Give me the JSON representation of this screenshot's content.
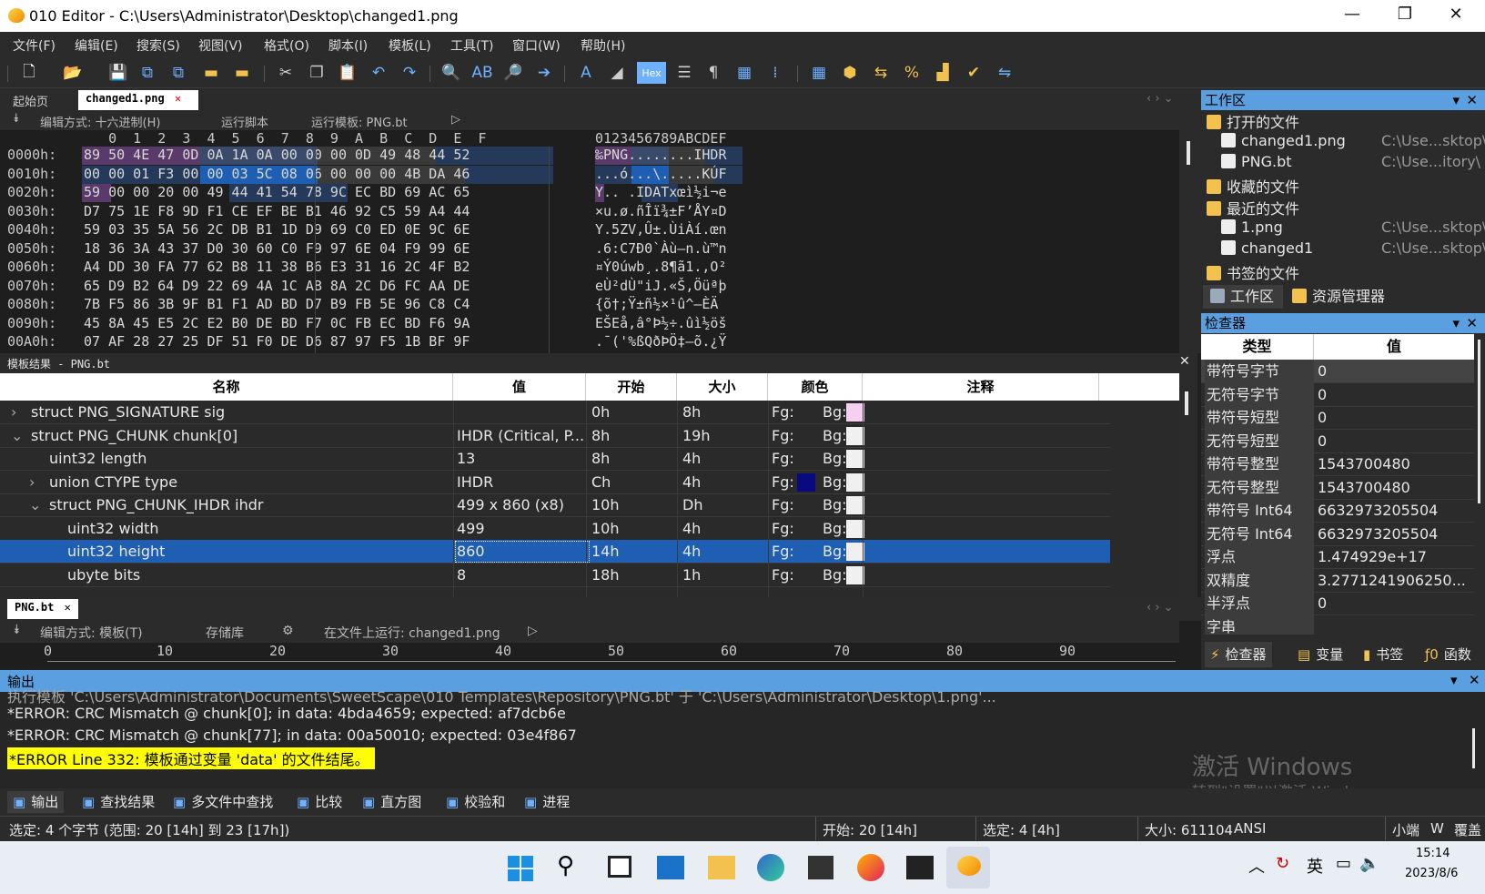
{
  "window": {
    "title": "010 Editor - C:\\Users\\Administrator\\Desktop\\changed1.png",
    "minimize": "—",
    "maximize": "❐",
    "close": "✕"
  },
  "menu": [
    "文件(F)",
    "编辑(E)",
    "搜索(S)",
    "视图(V)",
    "格式(O)",
    "脚本(I)",
    "模板(L)",
    "工具(T)",
    "窗口(W)",
    "帮助(H)"
  ],
  "tabs": {
    "start": "起始页",
    "file": "changed1.png",
    "close": "✕"
  },
  "hexbar": {
    "edit_mode": "编辑方式: 十六进制(H)",
    "run_script": "运行脚本",
    "run_template": "运行模板: PNG.bt"
  },
  "hex": {
    "col_header": "   0  1  2  3  4  5  6  7  8  9  A  B  C  D  E  F",
    "ascii_header": "0123456789ABCDEF",
    "rows": [
      {
        "addr": "0000h:",
        "bytes": "89 50 4E 47 0D 0A 1A 0A 00 00 00 0D 49 48 44 52",
        "ascii": "‰PNG........IHDR"
      },
      {
        "addr": "0010h:",
        "bytes": "00 00 01 F3 00 00 03 5C 08 06 00 00 00 4B DA 46",
        "ascii": "...ó...\\.....KÚF"
      },
      {
        "addr": "0020h:",
        "bytes": "59 00 00 20 00 49 44 41 54 78 9C EC BD 69 AC 65",
        "ascii": "Y.. .IDATxœì½i¬e"
      },
      {
        "addr": "0030h:",
        "bytes": "D7 75 1E F8 9D F1 CE EF BE B1 46 92 C5 59 A4 44",
        "ascii": "×u.ø.ñÎï¾±F’ÅY¤D"
      },
      {
        "addr": "0040h:",
        "bytes": "59 03 35 5A 56 2C DB B1 1D D9 69 C0 ED 0E 9C 6E",
        "ascii": "Y.5ZV,Û±.ÙiÀí.œn"
      },
      {
        "addr": "0050h:",
        "bytes": "18 36 3A 43 37 D0 30 60 C0 F9 97 6E 04 F9 99 6E",
        "ascii": ".6:C7Ð0`Àù—n.ù™n"
      },
      {
        "addr": "0060h:",
        "bytes": "A4 DD 30 FA 77 62 B8 11 38 B6 E3 31 16 2C 4F B2",
        "ascii": "¤Ý0úwb¸.8¶ã1.,O²"
      },
      {
        "addr": "0070h:",
        "bytes": "65 D9 B2 64 D9 22 69 4A 1C AB 8A 2C D6 FC AA DE",
        "ascii": "eÙ²dÙ\"iJ.«Š,Öüªþ"
      },
      {
        "addr": "0080h:",
        "bytes": "7B F5 86 3B 9F B1 F1 AD BD D7 B9 FB 5E 96 C8 C4",
        "ascii": "{õ†;Ÿ±ñ­½×¹û^–ÈÄ"
      },
      {
        "addr": "0090h:",
        "bytes": "45 8A 45 E5 2C E2 B0 DE BD F7 0C FB EC BD F6 9A",
        "ascii": "EŠEå,â°Þ½÷.ûì½öš"
      },
      {
        "addr": "00A0h:",
        "bytes": "07 AF 28 27 25 DF 51 F0 DE D6 87 97 F5 1B BF 9F",
        "ascii": ".¯('%ßQðÞÖ‡—õ.¿Ÿ"
      }
    ]
  },
  "template": {
    "title": "模板结果 - PNG.bt",
    "columns": [
      "名称",
      "值",
      "开始",
      "大小",
      "颜色",
      "注释"
    ],
    "rows": [
      {
        "name": "struct PNG_SIGNATURE sig",
        "value": "",
        "start": "0h",
        "size": "8h",
        "fg": "Fg:",
        "bg": "Bg:",
        "bgcolor": "#f5d0f0",
        "fgcolor": "",
        "indent": 0,
        "arrow": "›"
      },
      {
        "name": "struct PNG_CHUNK chunk[0]",
        "value": "IHDR  (Critical, P...",
        "start": "8h",
        "size": "19h",
        "fg": "Fg:",
        "bg": "Bg:",
        "bgcolor": "#f0f0f0",
        "fgcolor": "",
        "indent": 0,
        "arrow": "⌄"
      },
      {
        "name": "uint32 length",
        "value": "13",
        "start": "8h",
        "size": "4h",
        "fg": "Fg:",
        "bg": "Bg:",
        "bgcolor": "#f0f0f0",
        "fgcolor": "",
        "indent": 1,
        "arrow": ""
      },
      {
        "name": "union CTYPE type",
        "value": "IHDR",
        "start": "Ch",
        "size": "4h",
        "fg": "Fg:",
        "bg": "Bg:",
        "bgcolor": "#f0f0f0",
        "fgcolor": "#0a0a80",
        "indent": 1,
        "arrow": "›"
      },
      {
        "name": "struct PNG_CHUNK_IHDR ihdr",
        "value": "499 x 860 (x8)",
        "start": "10h",
        "size": "Dh",
        "fg": "Fg:",
        "bg": "Bg:",
        "bgcolor": "#f0f0f0",
        "fgcolor": "",
        "indent": 1,
        "arrow": "⌄"
      },
      {
        "name": "uint32 width",
        "value": "499",
        "start": "10h",
        "size": "4h",
        "fg": "Fg:",
        "bg": "Bg:",
        "bgcolor": "#f0f0f0",
        "fgcolor": "",
        "indent": 2,
        "arrow": ""
      },
      {
        "name": "uint32 height",
        "value": "860",
        "start": "14h",
        "size": "4h",
        "fg": "Fg:",
        "bg": "Bg:",
        "bgcolor": "#f0f0f0",
        "fgcolor": "",
        "indent": 2,
        "arrow": "",
        "selected": true
      },
      {
        "name": "ubyte bits",
        "value": "8",
        "start": "18h",
        "size": "1h",
        "fg": "Fg:",
        "bg": "Bg:",
        "bgcolor": "#f0f0f0",
        "fgcolor": "",
        "indent": 2,
        "arrow": ""
      }
    ]
  },
  "pngtab": {
    "label": "PNG.bt",
    "close": "✕"
  },
  "editbar2": {
    "edit_mode": "编辑方式: 模板(T)",
    "repo": "存储库",
    "run_on": "在文件上运行: changed1.png"
  },
  "ruler": [
    "0",
    "10",
    "20",
    "30",
    "40",
    "50",
    "60",
    "70",
    "80",
    "90"
  ],
  "output": {
    "title": "输出",
    "lines": [
      "执行模板 'C:\\Users\\Administrator\\Documents\\SweetScape\\010 Templates\\Repository\\PNG.bt' 于 'C:\\Users\\Administrator\\Desktop\\1.png'...",
      "*ERROR: CRC Mismatch @ chunk[0]; in data: 4bda4659; expected: af7dcb6e",
      "*ERROR: CRC Mismatch @ chunk[77]; in data: 00a50010; expected: 03e4f867",
      "*ERROR Line 332: 模板通过变量 'data' 的文件结尾。"
    ],
    "watermark1": "激活 Windows",
    "watermark2": "转到\"设置\"以激活 Windows。"
  },
  "bottom_tabs": [
    "输出",
    "查找结果",
    "多文件中查找",
    "比较",
    "直方图",
    "校验和",
    "进程"
  ],
  "status": {
    "selection": "选定: 4 个字节 (范围: 20 [14h] 到 23 [17h])",
    "start": "开始: 20 [14h]",
    "selected": "选定: 4 [4h]",
    "size": "大小: 611104",
    "encoding": "ANSI",
    "endian": "小端",
    "w": "W",
    "overwrite": "覆盖"
  },
  "workspace": {
    "title": "工作区",
    "items": [
      {
        "label": "打开的文件",
        "path": "",
        "indent": 0
      },
      {
        "label": "changed1.png",
        "path": "C:\\Use...sktop\\",
        "indent": 1
      },
      {
        "label": "PNG.bt",
        "path": "C:\\Use...itory\\",
        "indent": 1
      },
      {
        "label": "收藏的文件",
        "path": "",
        "indent": 0
      },
      {
        "label": "最近的文件",
        "path": "",
        "indent": 0
      },
      {
        "label": "1.png",
        "path": "C:\\Use...sktop\\",
        "indent": 1
      },
      {
        "label": "changed1",
        "path": "C:\\Use...sktop\\",
        "indent": 1
      },
      {
        "label": "书签的文件",
        "path": "",
        "indent": 0
      }
    ],
    "tab_workspace": "工作区",
    "tab_explorer": "资源管理器"
  },
  "inspector": {
    "title": "检查器",
    "col_type": "类型",
    "col_value": "值",
    "rows": [
      {
        "k": "带符号字节",
        "v": "0"
      },
      {
        "k": "无符号字节",
        "v": "0"
      },
      {
        "k": "带符号短型",
        "v": "0"
      },
      {
        "k": "无符号短型",
        "v": "0"
      },
      {
        "k": "带符号整型",
        "v": "1543700480"
      },
      {
        "k": "无符号整型",
        "v": "1543700480"
      },
      {
        "k": "带符号 Int64",
        "v": "6632973205504"
      },
      {
        "k": "无符号 Int64",
        "v": "6632973205504"
      },
      {
        "k": "浮点",
        "v": "1.474929e+17"
      },
      {
        "k": "双精度",
        "v": "3.2771241906250..."
      },
      {
        "k": "半浮点",
        "v": "0"
      },
      {
        "k": "字串",
        "v": ""
      }
    ],
    "tabs": [
      "检查器",
      "变量",
      "书签",
      "函数"
    ]
  },
  "taskbar": {
    "time": "15:14",
    "date": "2023/8/6",
    "lang": "英"
  },
  "colors": {
    "accent": "#5aa0e0",
    "selection": "#1f5fb3"
  }
}
